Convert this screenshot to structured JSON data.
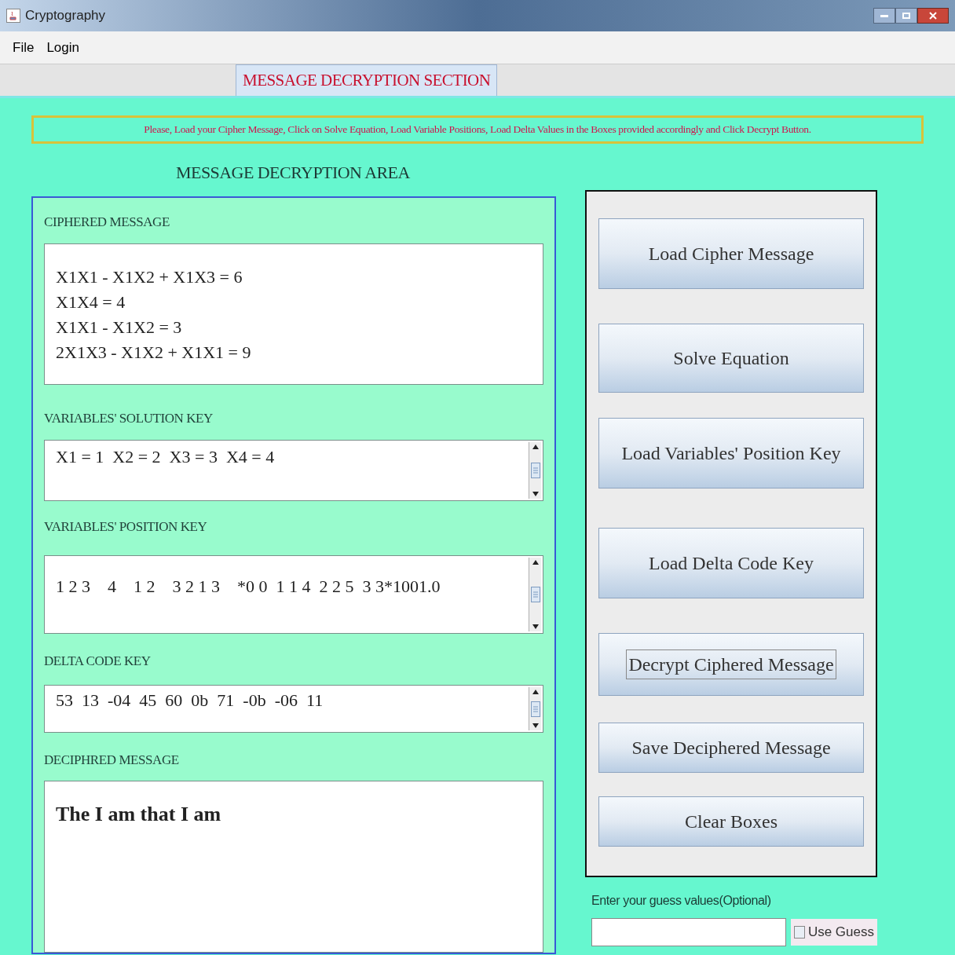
{
  "window": {
    "title": "Cryptography"
  },
  "menu": [
    "File",
    "Login"
  ],
  "tabs": [
    {
      "label": "MESSAGE DECRYPTION SECTION",
      "selected": true
    }
  ],
  "instruction": "Please, Load your Cipher Message, Click on Solve Equation, Load Variable Positions, Load  Delta Values  in the Boxes provided accordingly and Click Decrypt Button.",
  "area_title": "MESSAGE DECRYPTION AREA",
  "fields": [
    {
      "label": "CIPHERED MESSAGE",
      "kind": "plain",
      "lines": [
        "X1X1 - X1X2 + X1X3 = 6",
        "X1X4 = 4",
        "X1X1 - X1X2 = 3",
        "2X1X3 - X1X2 + X1X1 = 9"
      ]
    },
    {
      "label": "VARIABLES'  SOLUTION KEY",
      "kind": "scroll",
      "lines": [
        "X1 = 1  X2 = 2  X3 = 3  X4 = 4"
      ]
    },
    {
      "label": "VARIABLES' POSITION  KEY",
      "kind": "scroll",
      "lines": [
        "1 2 3    4    1 2    3 2 1 3    *0 0  1 1 4  2 2 5  3 3*1001.0"
      ]
    },
    {
      "label": "DELTA CODE  KEY",
      "kind": "scroll",
      "lines": [
        "53  13  -04  45  60  0b  71  -0b  -06  11"
      ]
    },
    {
      "label": "DECIPHRED MESSAGE",
      "kind": "large",
      "lines": [
        "The I am that I am"
      ]
    }
  ],
  "buttons": [
    {
      "label": "Load Cipher Message",
      "focused": false
    },
    {
      "label": "Solve Equation",
      "focused": false
    },
    {
      "label": "Load Variables'  Position  Key",
      "focused": false
    },
    {
      "label": "Load Delta Code Key",
      "focused": false
    },
    {
      "label": "Decrypt Ciphered Message",
      "focused": true
    },
    {
      "label": "Save Deciphered Message",
      "focused": false
    },
    {
      "label": "Clear Boxes",
      "focused": false
    }
  ],
  "guess": {
    "label": "Enter your guess values(Optional)",
    "checkbox": {
      "label": "Use Guess",
      "checked": false
    }
  }
}
